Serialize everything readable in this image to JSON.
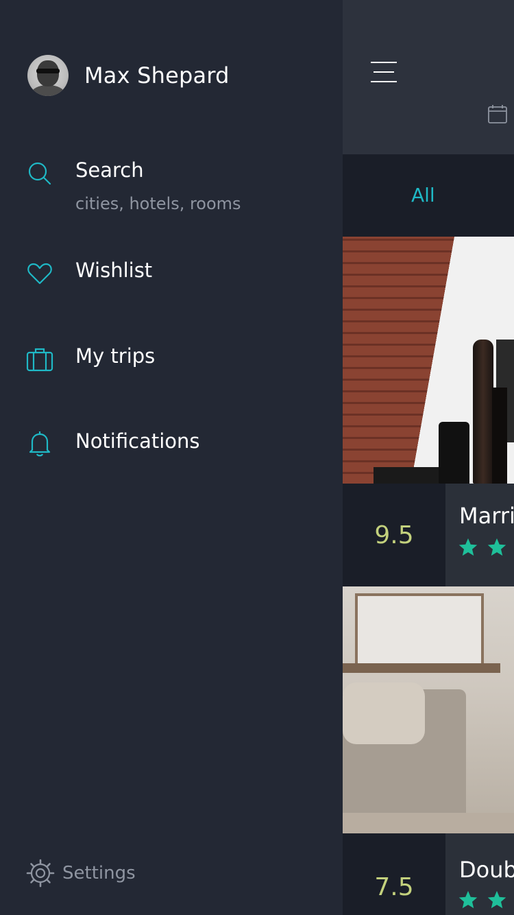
{
  "drawer": {
    "user": {
      "name": "Max Shepard",
      "avatar_icon": "user-avatar"
    },
    "items": [
      {
        "label": "Search",
        "sublabel": "cities, hotels, rooms",
        "icon": "search-icon"
      },
      {
        "label": "Wishlist",
        "icon": "heart-icon"
      },
      {
        "label": "My trips",
        "icon": "suitcase-icon"
      },
      {
        "label": "Notifications",
        "icon": "bell-icon"
      }
    ],
    "settings": {
      "label": "Settings",
      "icon": "gear-icon"
    }
  },
  "main": {
    "tabs": [
      {
        "label": "All",
        "active": true
      }
    ],
    "hotels": [
      {
        "rating": "9.5",
        "name": "Marric",
        "stars_visible": 2
      },
      {
        "rating": "7.5",
        "name": "Doub",
        "stars_visible": 2
      }
    ]
  },
  "colors": {
    "accent": "#1fb9c6",
    "rating": "#c3d17d",
    "star": "#1fbf9a",
    "drawer_bg": "#232834"
  }
}
